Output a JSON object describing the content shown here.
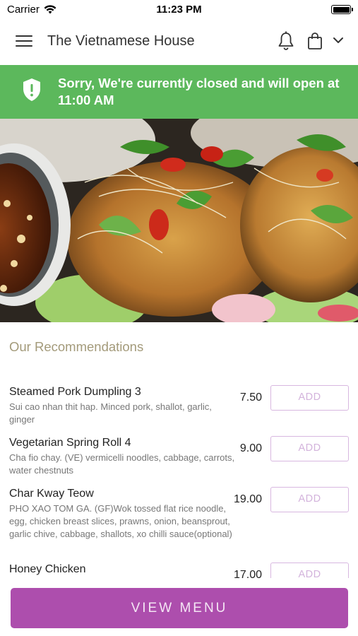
{
  "status_bar": {
    "carrier": "Carrier",
    "time": "11:23 PM",
    "icons": [
      "wifi-icon",
      "battery-icon"
    ]
  },
  "header": {
    "title": "The Vietnamese House",
    "icons": [
      "menu-icon",
      "bell-icon",
      "shopping-bag-icon",
      "chevron-down-icon"
    ]
  },
  "closed_banner": {
    "message": "Sorry, We're currently closed and will open at 11:00 AM",
    "icon": "shield-alert-icon",
    "color": "#5cb85c"
  },
  "hero_image": {
    "subject": "food-photo"
  },
  "recommendations": {
    "title": "Our Recommendations",
    "items": [
      {
        "name": "Steamed Pork Dumpling 3",
        "description": "Sui cao nhan thit hap. Minced pork, shallot, garlic, ginger",
        "price": "7.50",
        "button": "ADD"
      },
      {
        "name": "Vegetarian Spring Roll 4",
        "description": "Cha fio chay. (VE) vermicelli noodles, cabbage, carrots, water chestnuts",
        "price": "9.00",
        "button": "ADD"
      },
      {
        "name": "Char Kway Teow",
        "description": "PHO XAO TOM GA. (GF)Wok tossed flat rice noodle, egg, chicken breast slices, prawns, onion, beansprout, garlic chive, cabbage, shallots, xo chilli sauce(optional)",
        "price": "19.00",
        "button": "ADD"
      },
      {
        "name": "Honey Chicken",
        "description": "",
        "price": "17.00",
        "button": "ADD"
      }
    ]
  },
  "footer": {
    "view_menu_label": "VIEW MENU",
    "accent_color": "#ad4ead"
  }
}
